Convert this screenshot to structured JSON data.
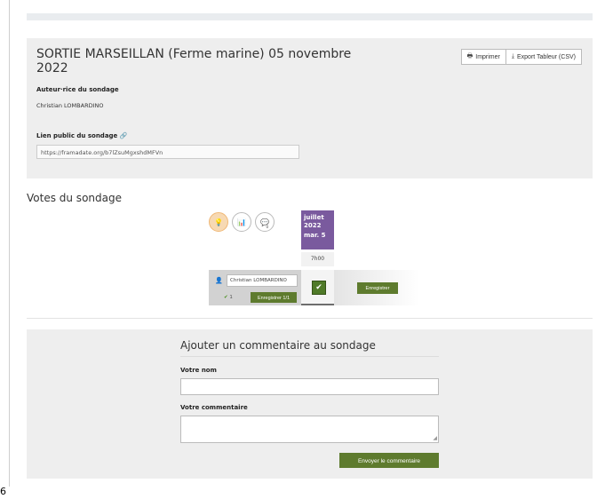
{
  "poll": {
    "title": "SORTIE MARSEILLAN (Ferme marine) 05 novembre 2022",
    "print_label": "Imprimer",
    "export_label": "Export Tableur (CSV)",
    "author_label": "Auteur·rice du sondage",
    "author_name": "Christian LOMBARDINO",
    "public_link_label": "Lien public du sondage",
    "public_link_icon": "🔗",
    "public_link_url": "https://framadate.org/b7lZsuMgxshdMFVn"
  },
  "votes": {
    "title": "Votes du sondage",
    "icons": {
      "lightbulb": "💡",
      "chart": "📊",
      "comment": "💬",
      "comment_count": "0"
    },
    "date_header": {
      "month": "juillet",
      "year": "2022",
      "day": "mar. 5"
    },
    "time_header": "7h00",
    "row": {
      "user_icon": "👤",
      "name_value": "Christian LOMBARDINO",
      "check_glyph": "✔",
      "ok_count": "1",
      "save_label": "Enregistrer 1/1"
    },
    "vote_cell": {
      "check_glyph": "✔",
      "color": "#4f7a28"
    },
    "save_label": "Enregistrer"
  },
  "comments": {
    "title": "Ajouter un commentaire au sondage",
    "name_label": "Votre nom",
    "name_value": "",
    "comment_label": "Votre commentaire",
    "comment_value": "",
    "send_label": "Envoyer le commentaire"
  },
  "page": {
    "corner_digit": "6"
  },
  "colors": {
    "accent_green": "#5e7b2e",
    "date_header": "#7a5a9e",
    "panel": "#eeeeee"
  }
}
